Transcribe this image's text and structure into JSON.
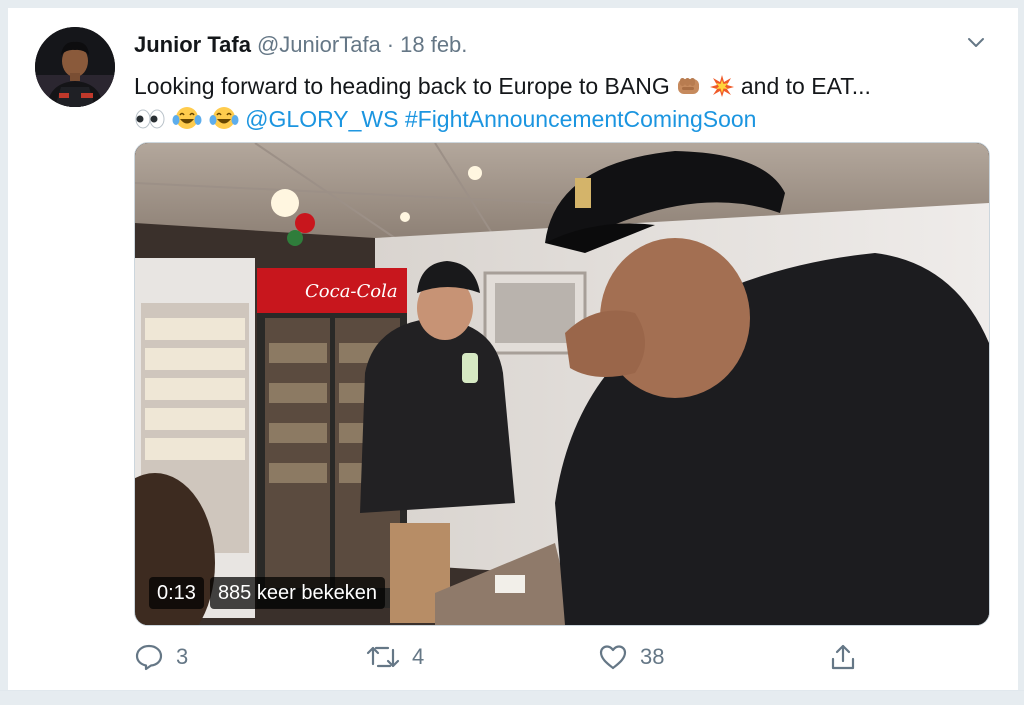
{
  "tweet": {
    "author_name": "Junior Tafa",
    "handle": "@JuniorTafa",
    "separator": "·",
    "date": "18 feb.",
    "text_part1": "Looking forward to heading back to Europe to BANG",
    "text_part2": "and to EAT...",
    "mention": "@GLORY_WS",
    "hashtag": "#FightAnnouncementComingSoon",
    "emojis": [
      "fist-emoji",
      "collision-emoji",
      "eyes-emoji",
      "tears-of-joy-emoji",
      "tears-of-joy-emoji"
    ]
  },
  "video": {
    "duration": "0:13",
    "views": "885 keer bekeken"
  },
  "actions": {
    "replies": "3",
    "retweets": "4",
    "likes": "38"
  },
  "colors": {
    "link": "#1b95e0",
    "muted": "#657786",
    "border": "#e6ecf0"
  }
}
